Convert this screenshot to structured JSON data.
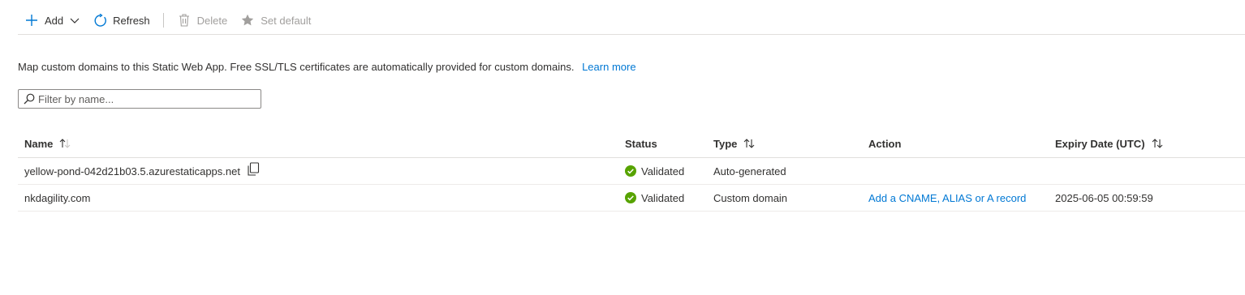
{
  "toolbar": {
    "add_label": "Add",
    "refresh_label": "Refresh",
    "delete_label": "Delete",
    "set_default_label": "Set default"
  },
  "description": {
    "text": "Map custom domains to this Static Web App. Free SSL/TLS certificates are automatically provided for custom domains.",
    "link_label": "Learn more"
  },
  "filter": {
    "placeholder": "Filter by name...",
    "value": ""
  },
  "table": {
    "columns": {
      "name": "Name",
      "status": "Status",
      "type": "Type",
      "action": "Action",
      "expiry": "Expiry Date (UTC)"
    },
    "rows": [
      {
        "name": "yellow-pond-042d21b03.5.azurestaticapps.net",
        "status": "Validated",
        "type": "Auto-generated",
        "action": "",
        "expiry": ""
      },
      {
        "name": "nkdagility.com",
        "status": "Validated",
        "type": "Custom domain",
        "action": "Add a CNAME, ALIAS or A record",
        "expiry": "2025-06-05 00:59:59"
      }
    ]
  },
  "colors": {
    "accent": "#0078d4",
    "success": "#57a300",
    "disabled": "#a19f9d"
  },
  "icons": [
    "plus-icon",
    "chevron-down-icon",
    "refresh-icon",
    "trash-icon",
    "star-icon",
    "search-icon",
    "sort-icon",
    "check-circle-icon",
    "copy-icon"
  ]
}
